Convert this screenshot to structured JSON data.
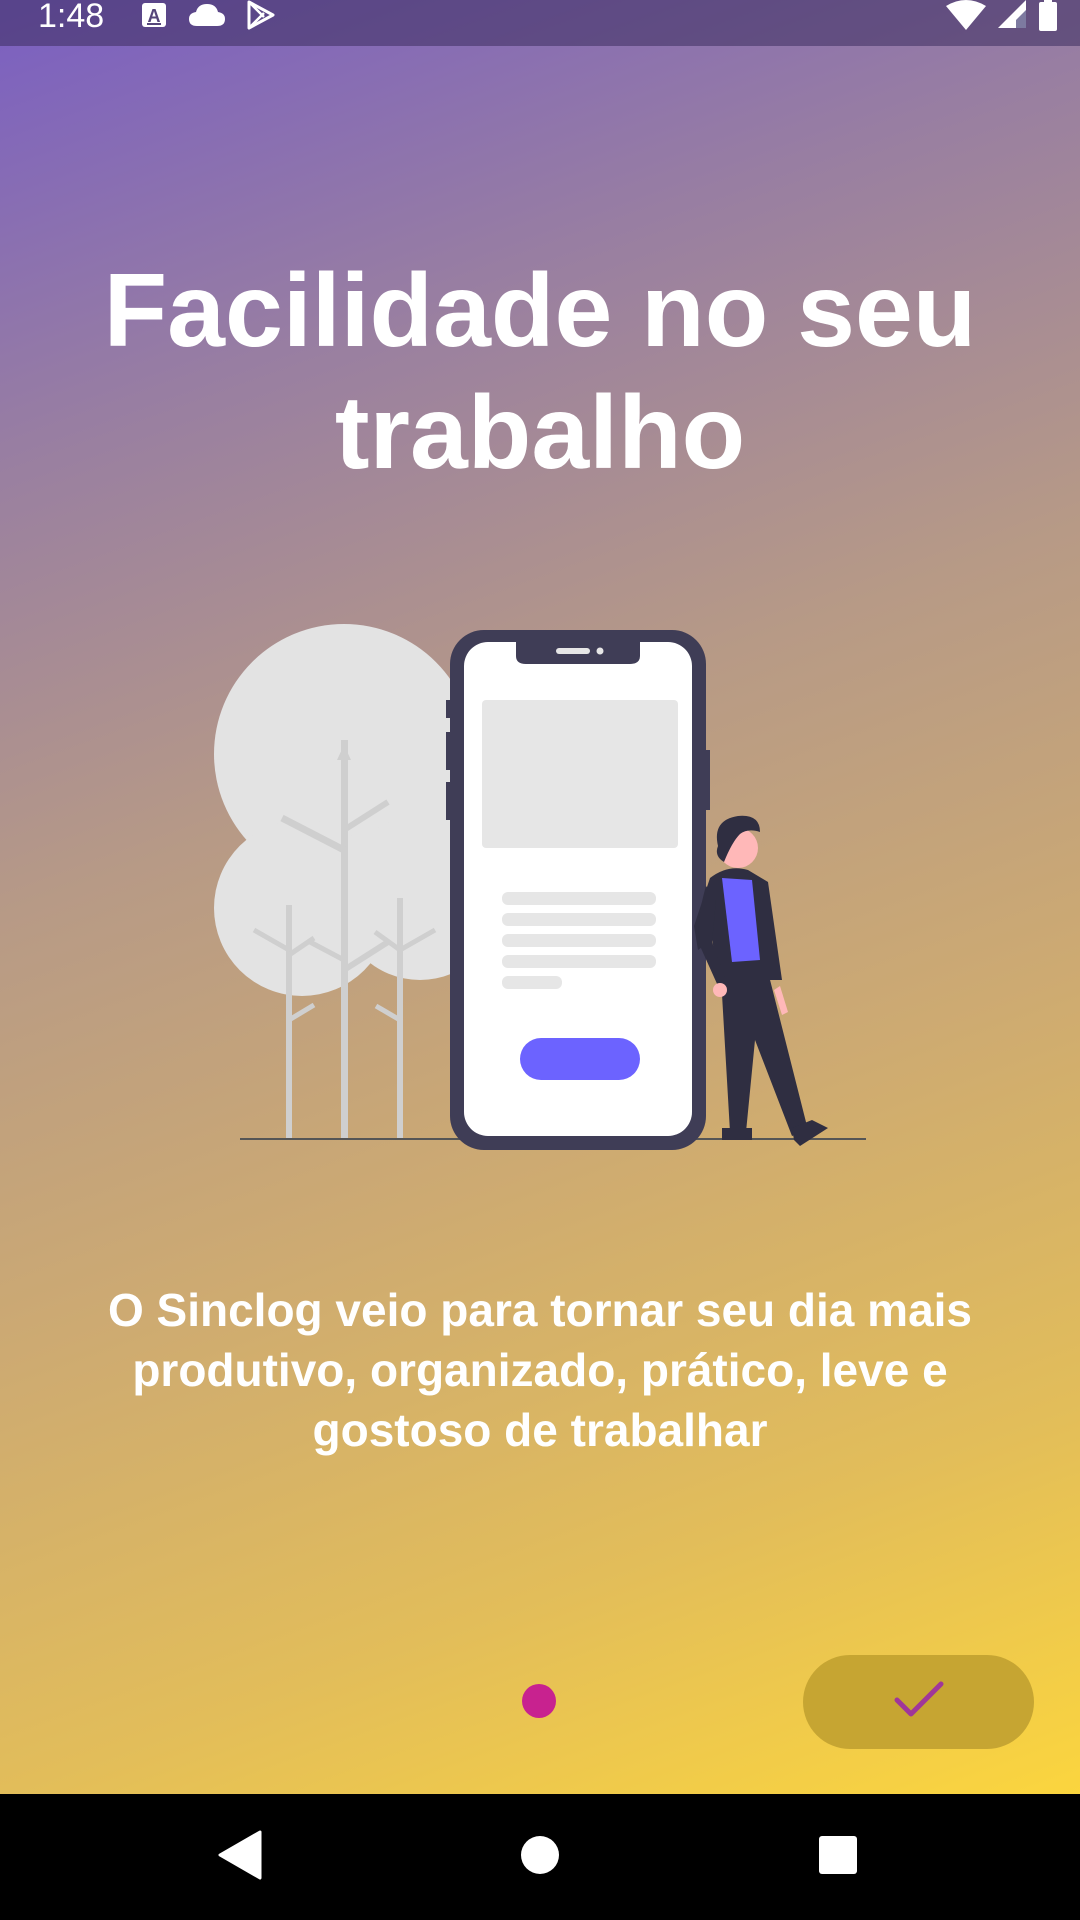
{
  "status_bar": {
    "time": "1:48",
    "icons": [
      "keyboard-a-icon",
      "cloud-icon",
      "play-store-icon",
      "wifi-icon",
      "cell-signal-icon",
      "battery-icon"
    ]
  },
  "onboarding": {
    "title": "Facilidade no seu trabalho",
    "description": "O Sinclog veio para tornar seu dia mais produtivo, organizado, prático, leve e gostoso de trabalhar",
    "page_count": 1,
    "current_page": 1,
    "done_icon": "check-icon"
  },
  "colors": {
    "gradient_start": "#7a5fc2",
    "gradient_end": "#fbd53e",
    "dot": "#c8228f",
    "done_button": "#c6a532",
    "done_check": "#a0369a",
    "accent_illustration": "#6c63ff"
  },
  "nav_bar": {
    "buttons": [
      "back-icon",
      "home-icon",
      "recents-icon"
    ]
  }
}
